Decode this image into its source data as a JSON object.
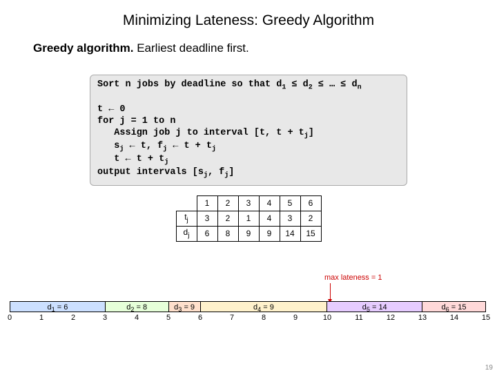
{
  "title": "Minimizing Lateness:  Greedy Algorithm",
  "statement_bold": "Greedy algorithm.",
  "statement_rest": "  Earliest deadline first.",
  "code": {
    "l1a": "Sort n jobs by deadline so that d",
    "l1b": " ≤ d",
    "l1c": " ≤ … ≤ d",
    "l2": "",
    "l3": "t ← 0",
    "l4": "for j = 1 to n",
    "l5a": "   Assign job j to interval [t, t + t",
    "l5b": "]",
    "l6a": "   s",
    "l6b": " ← t, f",
    "l6c": " ← t + t",
    "l7a": "   t ← t + t",
    "l8a": "output intervals [s",
    "l8b": ", f",
    "l8c": "]",
    "sub1": "1",
    "sub2": "2",
    "subn": "n",
    "subj": "j"
  },
  "table": {
    "head": [
      "1",
      "2",
      "3",
      "4",
      "5",
      "6"
    ],
    "t_label": "tj",
    "d_label": "dj",
    "t_row": [
      "3",
      "2",
      "1",
      "4",
      "3",
      "2"
    ],
    "d_row": [
      "6",
      "8",
      "9",
      "9",
      "14",
      "15"
    ]
  },
  "max_lateness": "max lateness = 1",
  "schedule": {
    "bars": [
      {
        "label": "d1 = 6",
        "width": 3,
        "cls": "b1"
      },
      {
        "label": "d2 = 8",
        "width": 2,
        "cls": "b2"
      },
      {
        "label": "d3 = 9",
        "width": 1,
        "cls": "b3"
      },
      {
        "label": "d4 = 9",
        "width": 4,
        "cls": "b4"
      },
      {
        "label": "d5 = 14",
        "width": 3,
        "cls": "b5"
      },
      {
        "label": "d6 = 15",
        "width": 2,
        "cls": "b6"
      }
    ],
    "ticks": [
      "0",
      "1",
      "2",
      "3",
      "4",
      "5",
      "6",
      "7",
      "8",
      "9",
      "10",
      "11",
      "12",
      "13",
      "14",
      "15"
    ]
  },
  "page_number": "19",
  "chart_data": {
    "type": "table",
    "title": "Job table",
    "columns": [
      "j",
      "tj",
      "dj"
    ],
    "rows": [
      [
        1,
        3,
        6
      ],
      [
        2,
        2,
        8
      ],
      [
        3,
        1,
        9
      ],
      [
        4,
        4,
        9
      ],
      [
        5,
        3,
        14
      ],
      [
        6,
        2,
        15
      ]
    ],
    "schedule_intervals": [
      {
        "job": 1,
        "start": 0,
        "finish": 3,
        "deadline": 6
      },
      {
        "job": 2,
        "start": 3,
        "finish": 5,
        "deadline": 8
      },
      {
        "job": 3,
        "start": 5,
        "finish": 6,
        "deadline": 9
      },
      {
        "job": 4,
        "start": 6,
        "finish": 10,
        "deadline": 9
      },
      {
        "job": 5,
        "start": 10,
        "finish": 13,
        "deadline": 14
      },
      {
        "job": 6,
        "start": 13,
        "finish": 15,
        "deadline": 15
      }
    ],
    "max_lateness": 1
  }
}
